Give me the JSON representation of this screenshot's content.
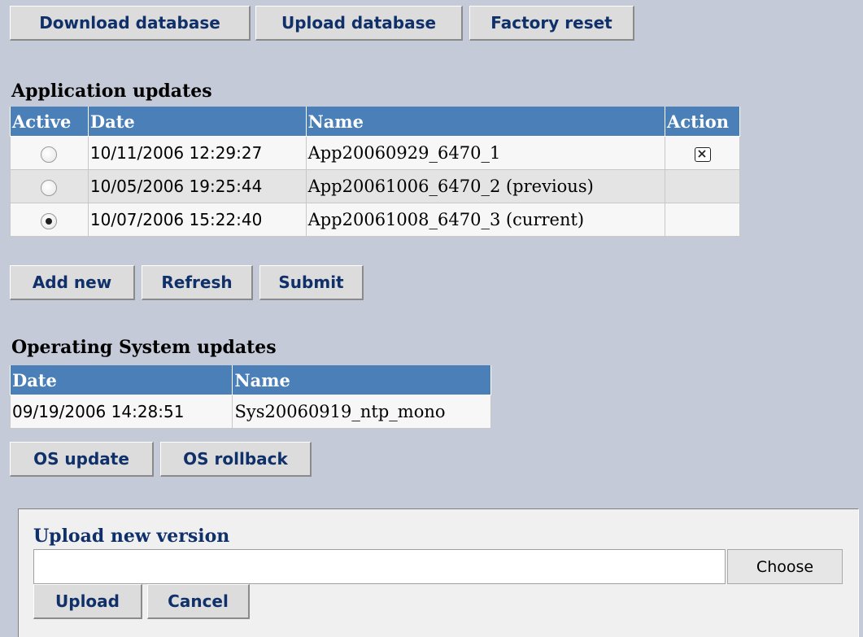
{
  "toolbar": {
    "download_label": "Download database",
    "upload_label": "Upload database",
    "reset_label": "Factory reset"
  },
  "app_updates": {
    "title": "Application updates",
    "headers": {
      "active": "Active",
      "date": "Date",
      "name": "Name",
      "action": "Action"
    },
    "rows": [
      {
        "active": false,
        "date": "10/11/2006 12:29:27",
        "name": "App20060929_6470_1",
        "deletable": true
      },
      {
        "active": false,
        "date": "10/05/2006 19:25:44",
        "name": "App20061006_6470_2 (previous)",
        "deletable": false
      },
      {
        "active": true,
        "date": "10/07/2006 15:22:40",
        "name": "App20061008_6470_3 (current)",
        "deletable": false
      }
    ],
    "buttons": {
      "add_new": "Add new",
      "refresh": "Refresh",
      "submit": "Submit"
    }
  },
  "os_updates": {
    "title": "Operating System updates",
    "headers": {
      "date": "Date",
      "name": "Name"
    },
    "rows": [
      {
        "date": "09/19/2006 14:28:51",
        "name": "Sys20060919_ntp_mono"
      }
    ],
    "buttons": {
      "update": "OS update",
      "rollback": "OS rollback"
    }
  },
  "upload_panel": {
    "title": "Upload new version",
    "file_value": "",
    "choose_label": "Choose",
    "upload_label": "Upload",
    "cancel_label": "Cancel"
  },
  "colors": {
    "page_bg": "#c5cad8",
    "header_bg": "#4a7fb8",
    "button_text": "#10306a",
    "panel_bg": "#f0f0f0"
  }
}
